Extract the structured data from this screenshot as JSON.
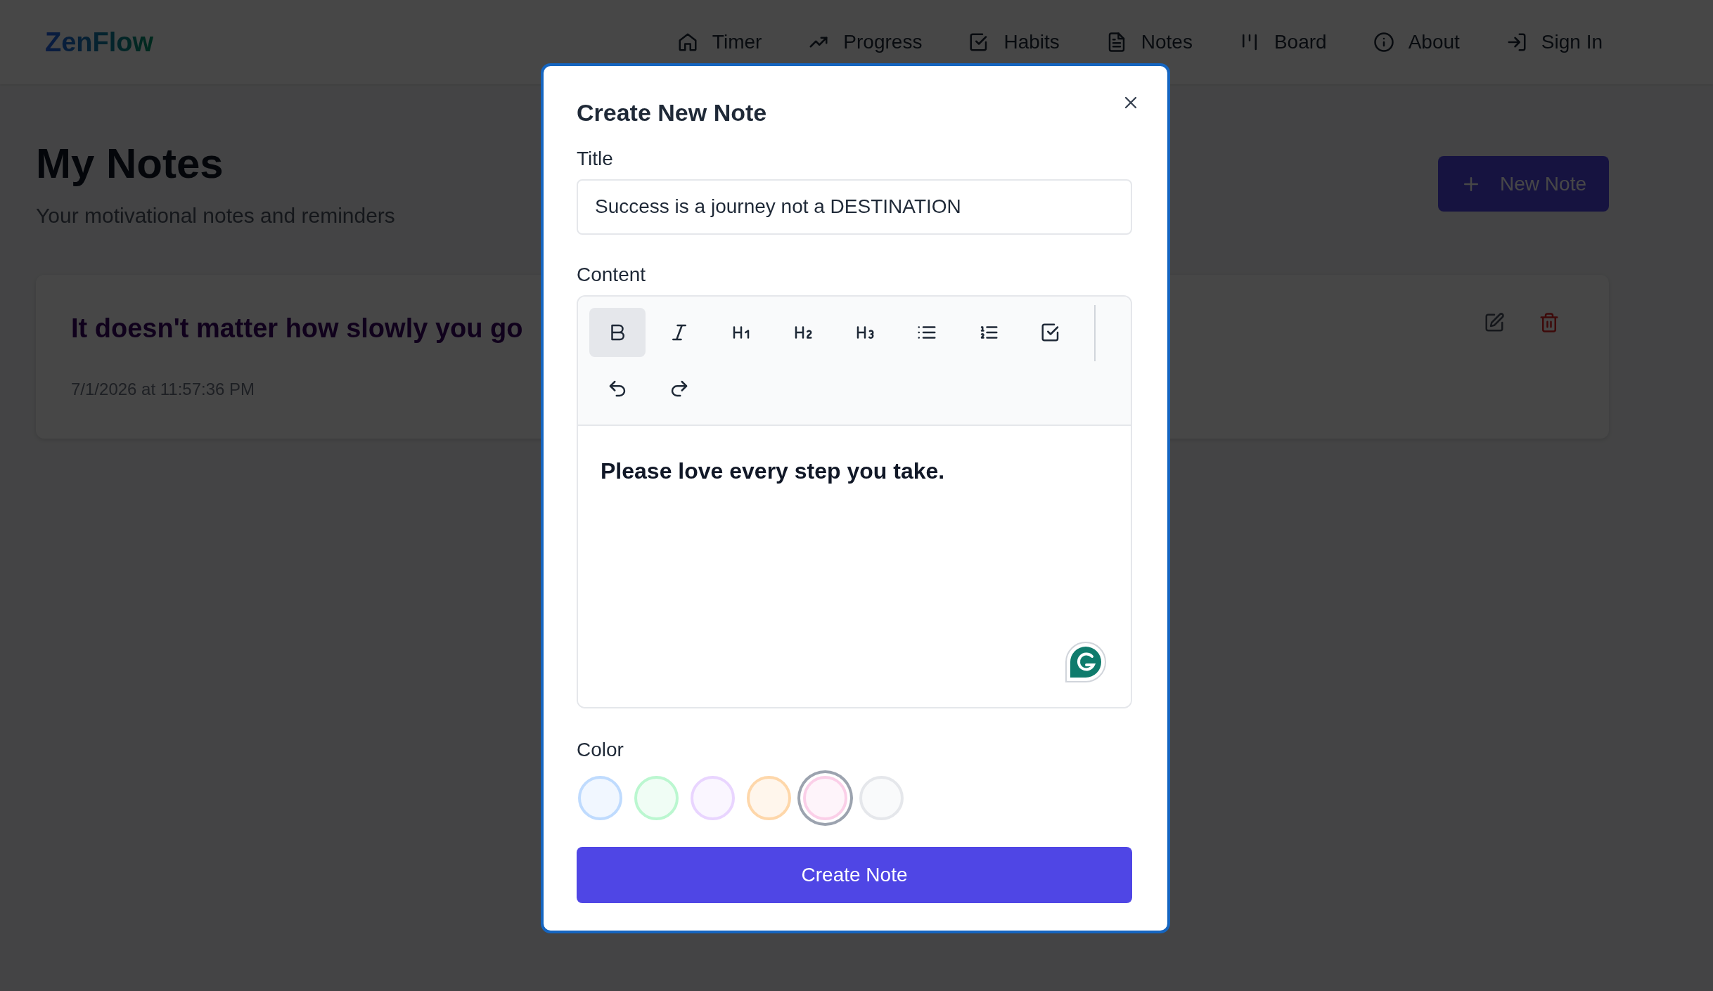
{
  "brand": "ZenFlow",
  "nav": [
    {
      "label": "Timer"
    },
    {
      "label": "Progress"
    },
    {
      "label": "Habits"
    },
    {
      "label": "Notes"
    },
    {
      "label": "Board"
    },
    {
      "label": "About"
    },
    {
      "label": "Sign In"
    }
  ],
  "page": {
    "title": "My Notes",
    "subtitle": "Your motivational notes and reminders",
    "new_button": "New Note"
  },
  "notes": [
    {
      "title": "It doesn't matter how slowly you go",
      "date": "7/1/2026 at 11:57:36 PM"
    }
  ],
  "modal": {
    "title": "Create New Note",
    "title_label": "Title",
    "title_value": "Success is a journey not a DESTINATION",
    "content_label": "Content",
    "toolbar": [
      {
        "kind": "bold",
        "selected": true
      },
      {
        "kind": "italic",
        "selected": false
      },
      {
        "kind": "h1",
        "selected": false
      },
      {
        "kind": "h2",
        "selected": false
      },
      {
        "kind": "h3",
        "selected": false
      },
      {
        "kind": "bullets",
        "selected": false
      },
      {
        "kind": "numbers",
        "selected": false
      },
      {
        "kind": "task",
        "selected": false
      },
      {
        "kind": "undo",
        "selected": false
      },
      {
        "kind": "redo",
        "selected": false
      }
    ],
    "content": "Please love every step you take.",
    "color_label": "Color",
    "colors": [
      {
        "color": "#bfdbfe",
        "selected": false
      },
      {
        "color": "#bbf7d0",
        "selected": false
      },
      {
        "color": "#e9d5ff",
        "selected": false
      },
      {
        "color": "#fed7aa",
        "selected": false
      },
      {
        "color": "#fbcfe8",
        "selected": true
      },
      {
        "color": "#e5e7eb",
        "selected": false
      }
    ],
    "submit": "Create Note"
  }
}
